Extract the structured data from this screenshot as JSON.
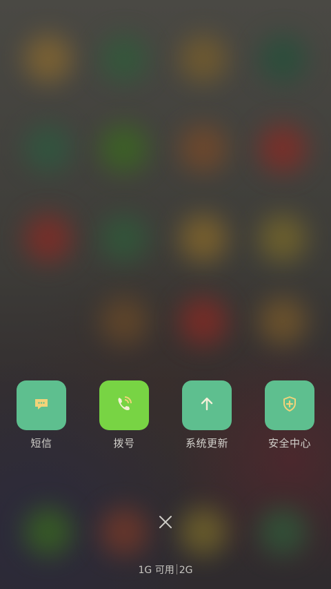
{
  "shortcuts": [
    {
      "label": "短信",
      "icon": "message-icon",
      "color": "#5ebf8f"
    },
    {
      "label": "拨号",
      "icon": "phone-icon",
      "color": "#78d444"
    },
    {
      "label": "系统更新",
      "icon": "arrow-up-icon",
      "color": "#5ebf8f"
    },
    {
      "label": "安全中心",
      "icon": "shield-plus-icon",
      "color": "#5ebf8f"
    }
  ],
  "memory": {
    "available": "1G 可用",
    "total": "2G"
  },
  "close_icon": "close-icon",
  "colors": {
    "tile_green": "#5ebf8f",
    "tile_lime": "#78d444",
    "icon_yellow": "#f2d37a"
  }
}
